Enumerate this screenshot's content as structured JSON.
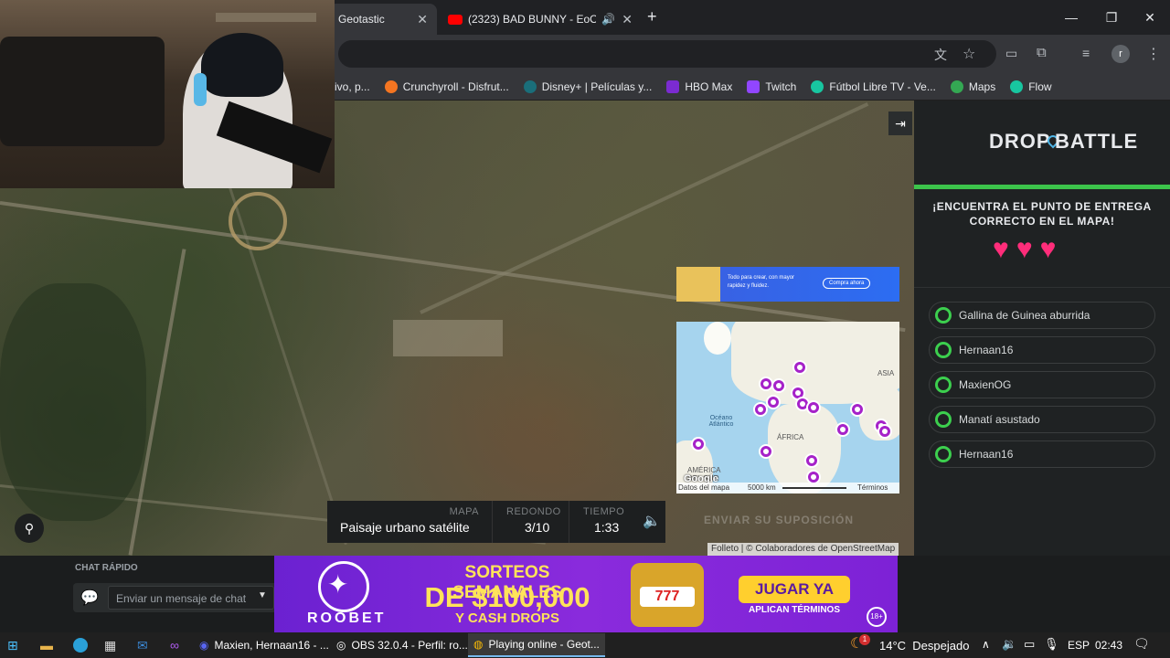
{
  "browser": {
    "tabs": [
      {
        "label": "Geotastic",
        "active": true
      },
      {
        "label": "(2323) BAD BUNNY - EoO (",
        "active": false
      }
    ],
    "bookmarks": [
      {
        "label": "ivo, p...",
        "color": "#e8eaed"
      },
      {
        "label": "Crunchyroll - Disfrut...",
        "color": "#f47521"
      },
      {
        "label": "Disney+ | Películas y...",
        "color": "#1a6e7a"
      },
      {
        "label": "HBO Max",
        "color": "#7b2bd1"
      },
      {
        "label": "Twitch",
        "color": "#9146ff"
      },
      {
        "label": "Fútbol Libre TV - Ve...",
        "color": "#18c6a0"
      },
      {
        "label": "Maps",
        "color": "#34a853"
      },
      {
        "label": "Flow",
        "color": "#18c6a0"
      }
    ],
    "profile_initial": "r"
  },
  "game": {
    "logo_left": "DROP",
    "logo_right": "BATTLE",
    "prompt": "¡ENCUENTRA EL PUNTO DE ENTREGA CORRECTO EN EL MAPA!",
    "hearts": [
      "♥",
      "♥",
      "♥"
    ],
    "players": [
      "Gallina de Guinea aburrida",
      "Hernaan16",
      "MaxienOG",
      "Manatí asustado",
      "Hernaan16"
    ],
    "info": {
      "map_label": "MAPA",
      "map_value": "Paisaje urbano satélite",
      "round_label": "REDONDO",
      "round_value": "3/10",
      "time_label": "TIEMPO",
      "time_value": "1:33"
    },
    "submit_label": "ENVIAR SU SUPOSICIÓN",
    "attribution": "Folleto | © Colaboradores de OpenStreetMap",
    "minimap": {
      "label_asia": "ASIA",
      "label_ocean": "Océano Atlántico",
      "label_africa": "ÁFRICA",
      "label_america": "AMÉRICA DEL SUR",
      "footer_data": "Datos del mapa",
      "footer_scale": "5000 km",
      "footer_terms": "Términos",
      "google": "Google",
      "ad_text": "Todo para crear, con mayor rapidez y fluidez.",
      "ad_button": "Compra ahora"
    }
  },
  "overlay": {
    "chat_title": "CHAT RÁPIDO",
    "chat_placeholder": "Enviar un mensaje de chat",
    "banner_title": "SORTEOS SEMANALES",
    "banner_amount": "DE $100,000",
    "banner_sub": "Y CASH DROPS",
    "banner_brand": "ROOBET",
    "banner_cta": "JUGAR YA",
    "banner_cta_sub": "APLICAN TÉRMINOS",
    "banner_age": "18+",
    "slot": "777"
  },
  "taskbar": {
    "apps": [
      {
        "label": "Maxien, Hernaan16 - ...",
        "active": false
      },
      {
        "label": "OBS 32.0.4 - Perfil: ro...",
        "active": false
      },
      {
        "label": "Playing online - Geot...",
        "active": true
      }
    ],
    "weather": "14°C  Despejado",
    "lang": "ESP",
    "time": "02:43",
    "notif_count": "1"
  }
}
